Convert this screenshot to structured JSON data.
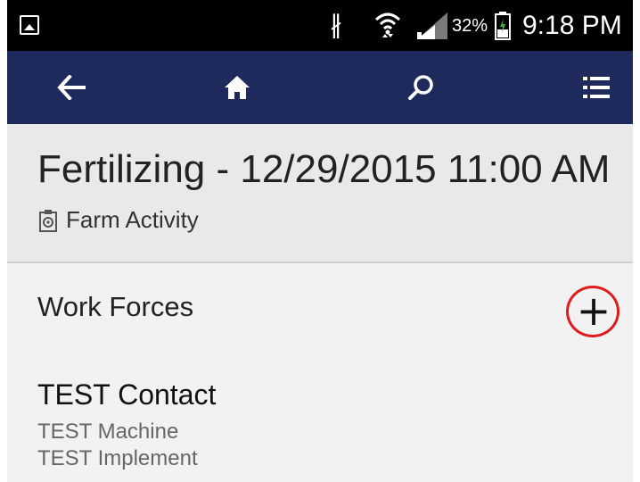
{
  "status_bar": {
    "icons": [
      "gallery-icon",
      "bluetooth-icon",
      "wifi-icon",
      "signal-icon",
      "battery-icon"
    ],
    "battery_percent": "32%",
    "time": "9:18 PM"
  },
  "app_bar": {
    "background": "#1e2a5c",
    "buttons": [
      {
        "icon": "back-arrow-icon"
      },
      {
        "icon": "home-icon"
      },
      {
        "icon": "search-icon"
      },
      {
        "icon": "list-menu-icon"
      }
    ]
  },
  "record": {
    "title": "Fertilizing - 12/29/2015 11:00 AM",
    "entity_icon": "clipboard-icon",
    "entity_label": "Farm Activity"
  },
  "section": {
    "title": "Work Forces",
    "add_icon": "plus-icon",
    "add_glyph": "+",
    "highlight_color": "#e01b1b"
  },
  "items": [
    {
      "primary": "TEST Contact",
      "secondary_1": "TEST Machine",
      "secondary_2": "TEST Implement"
    }
  ]
}
